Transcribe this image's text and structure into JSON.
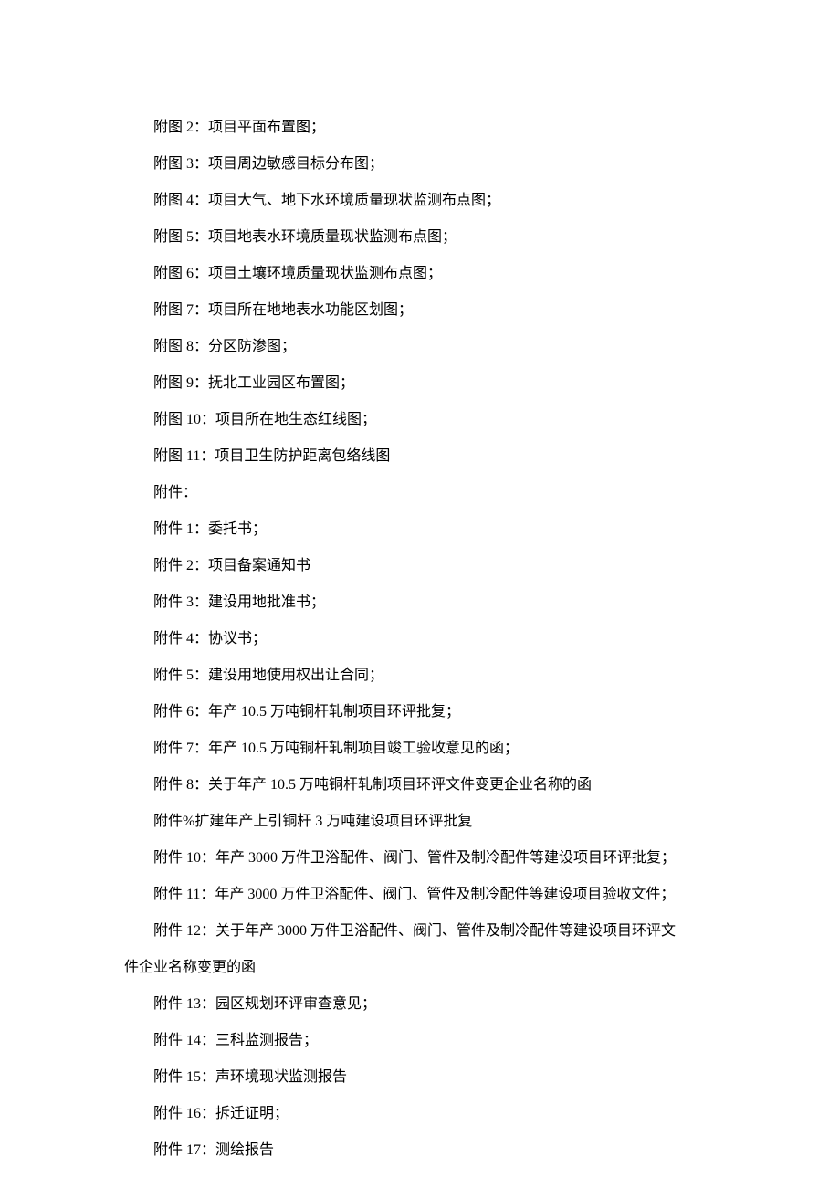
{
  "lines": [
    {
      "indent": true,
      "text": "附图 2：项目平面布置图；"
    },
    {
      "indent": true,
      "text": "附图 3：项目周边敏感目标分布图；"
    },
    {
      "indent": true,
      "text": "附图 4：项目大气、地下水环境质量现状监测布点图；"
    },
    {
      "indent": true,
      "text": "附图 5：项目地表水环境质量现状监测布点图；"
    },
    {
      "indent": true,
      "text": "附图 6：项目土壤环境质量现状监测布点图；"
    },
    {
      "indent": true,
      "text": "附图 7：项目所在地地表水功能区划图；"
    },
    {
      "indent": true,
      "text": "附图 8：分区防渗图；"
    },
    {
      "indent": true,
      "text": "附图 9：抚北工业园区布置图；"
    },
    {
      "indent": true,
      "text": "附图 10：项目所在地生态红线图；"
    },
    {
      "indent": true,
      "text": "附图 11：项目卫生防护距离包络线图"
    },
    {
      "indent": true,
      "text": "附件："
    },
    {
      "indent": true,
      "text": "附件 1：委托书；"
    },
    {
      "indent": true,
      "text": "附件 2：项目备案通知书"
    },
    {
      "indent": true,
      "text": "附件 3：建设用地批准书；"
    },
    {
      "indent": true,
      "text": "附件 4：协议书；"
    },
    {
      "indent": true,
      "text": "附件 5：建设用地使用权出让合同；"
    },
    {
      "indent": true,
      "text": "附件 6：年产 10.5 万吨铜杆轧制项目环评批复；"
    },
    {
      "indent": true,
      "text": "附件 7：年产 10.5 万吨铜杆轧制项目竣工验收意见的函；"
    },
    {
      "indent": true,
      "text": "附件 8：关于年产 10.5 万吨铜杆轧制项目环评文件变更企业名称的函"
    },
    {
      "indent": true,
      "text": "附件%扩建年产上引铜杆 3 万吨建设项目环评批复"
    },
    {
      "indent": true,
      "text": "附件 10：年产 3000 万件卫浴配件、阀门、管件及制冷配件等建设项目环评批复；"
    },
    {
      "indent": true,
      "text": "附件 11：年产 3000 万件卫浴配件、阀门、管件及制冷配件等建设项目验收文件；"
    },
    {
      "indent": true,
      "text": "附件 12：关于年产 3000 万件卫浴配件、阀门、管件及制冷配件等建设项目环评文"
    },
    {
      "indent": false,
      "text": "件企业名称变更的函"
    },
    {
      "indent": true,
      "text": "附件 13：园区规划环评审查意见；"
    },
    {
      "indent": true,
      "text": "附件 14：三科监测报告；"
    },
    {
      "indent": true,
      "text": "附件 15：声环境现状监测报告"
    },
    {
      "indent": true,
      "text": "附件 16：拆迁证明；"
    },
    {
      "indent": true,
      "text": "附件 17：测绘报告"
    }
  ]
}
